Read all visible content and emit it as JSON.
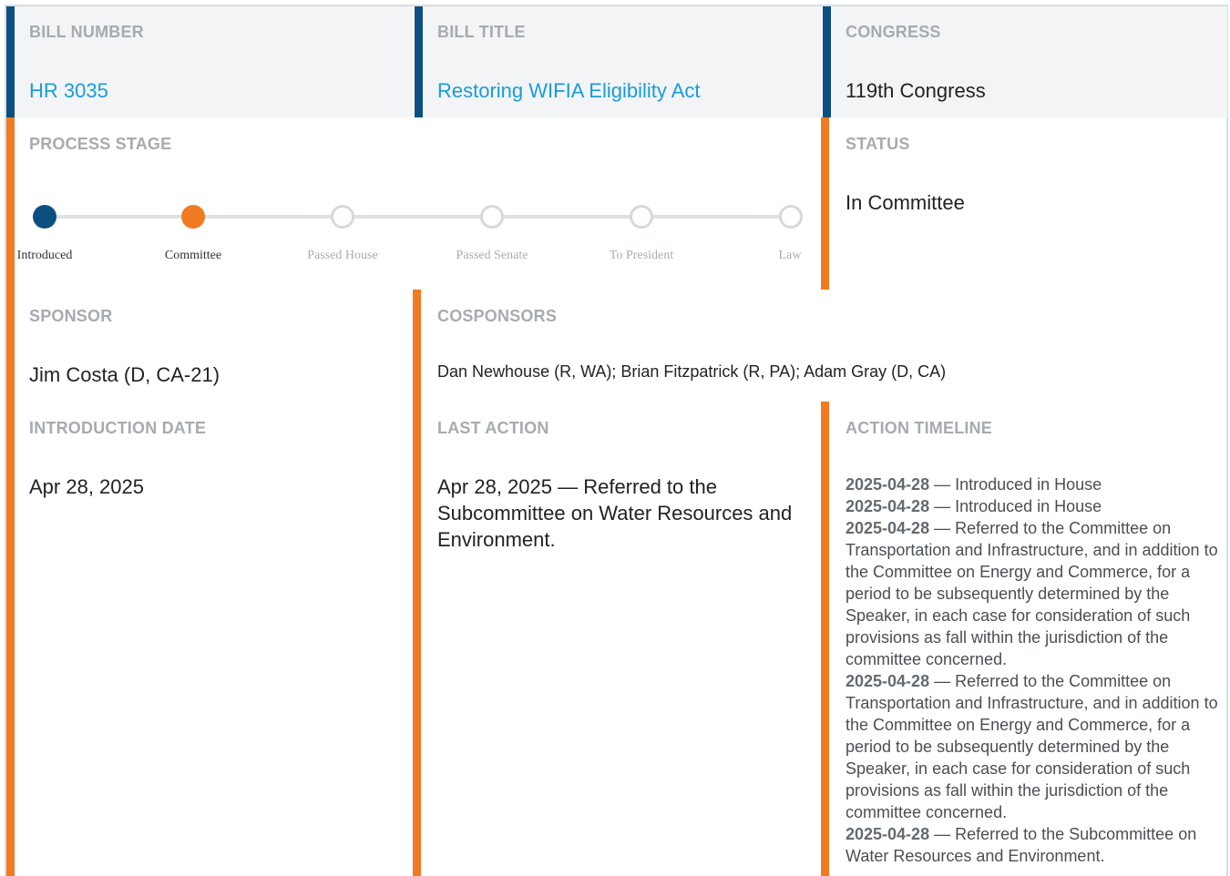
{
  "bill_number": {
    "label": "BILL NUMBER",
    "value": "HR 3035"
  },
  "bill_title": {
    "label": "BILL TITLE",
    "value": "Restoring WIFIA Eligibility Act"
  },
  "congress": {
    "label": "CONGRESS",
    "value": "119th Congress"
  },
  "process_stage": {
    "label": "PROCESS STAGE",
    "stages": [
      "Introduced",
      "Committee",
      "Passed House",
      "Passed Senate",
      "To President",
      "Law"
    ]
  },
  "status": {
    "label": "STATUS",
    "value": "In Committee"
  },
  "sponsor": {
    "label": "SPONSOR",
    "value": "Jim Costa (D, CA-21)"
  },
  "cosponsors": {
    "label": "COSPONSORS",
    "value": "Dan Newhouse (R, WA); Brian Fitzpatrick (R, PA); Adam Gray (D, CA)"
  },
  "introduction_date": {
    "label": "INTRODUCTION DATE",
    "value": "Apr 28, 2025"
  },
  "last_action": {
    "label": "LAST ACTION",
    "value": "Apr 28, 2025 — Referred to the Subcommittee on Water Resources and Environment."
  },
  "action_timeline": {
    "label": "ACTION TIMELINE",
    "entries": [
      {
        "date": "2025-04-28",
        "text": " — Introduced in House"
      },
      {
        "date": "2025-04-28",
        "text": " — Introduced in House"
      },
      {
        "date": "2025-04-28",
        "text": " — Referred to the Committee on Transportation and Infrastructure, and in addition to the Committee on Energy and Commerce, for a period to be subsequently determined by the Speaker, in each case for consideration of such provisions as fall within the jurisdiction of the committee concerned."
      },
      {
        "date": "2025-04-28",
        "text": " — Referred to the Committee on Transportation and Infrastructure, and in addition to the Committee on Energy and Commerce, for a period to be subsequently determined by the Speaker, in each case for consideration of such provisions as fall within the jurisdiction of the committee concerned."
      },
      {
        "date": "2025-04-28",
        "text": " — Referred to the Subcommittee on Water Resources and Environment."
      }
    ]
  },
  "colors": {
    "blue": "#0e4f82",
    "orange": "#f07b22",
    "link": "#1a9cd8"
  }
}
